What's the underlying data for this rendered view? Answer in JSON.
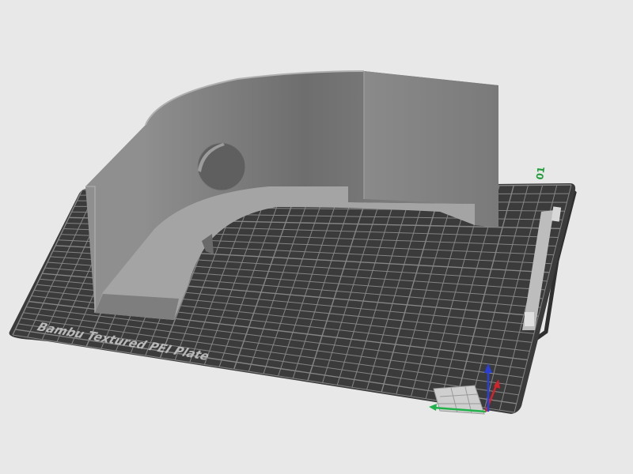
{
  "viewport": {
    "background": "#e8e8e8"
  },
  "plate": {
    "label": "Bambu Textured PEI Plate",
    "number": "01",
    "surface_color": "#3b3b3b",
    "grid_color": "#8a8a8a",
    "number_color": "#1f9d3a"
  },
  "model": {
    "color": "#8c8c8c"
  },
  "axes": {
    "x_color": "#22b24c",
    "y_color": "#d4232b",
    "z_color": "#2a3fd6"
  },
  "icons": {
    "plate": "build-plate-icon",
    "axes": "axis-gizmo-icon",
    "hole": "circle-icon"
  }
}
